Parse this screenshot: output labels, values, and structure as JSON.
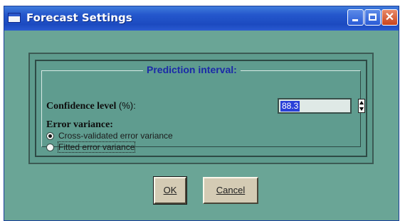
{
  "window": {
    "title": "Forecast Settings",
    "icon": "app-window-icon",
    "controls": [
      "minimize-icon",
      "maximize-icon",
      "close-icon"
    ]
  },
  "prediction_interval": {
    "group_title": "Prediction interval:",
    "confidence_label": "Confidence level",
    "confidence_unit": "(%):",
    "confidence_value": "88.3",
    "error_variance_label": "Error variance:",
    "options": [
      {
        "label": "Cross-validated error variance",
        "selected": true
      },
      {
        "label": "Fitted error variance",
        "selected": false
      }
    ]
  },
  "buttons": {
    "ok": "OK",
    "cancel": "Cancel"
  },
  "colors": {
    "dialog_bg": "#6aa596",
    "titlebar": "#2457cc",
    "accent_title": "#1b2aa8",
    "selection": "#2a40d8"
  }
}
